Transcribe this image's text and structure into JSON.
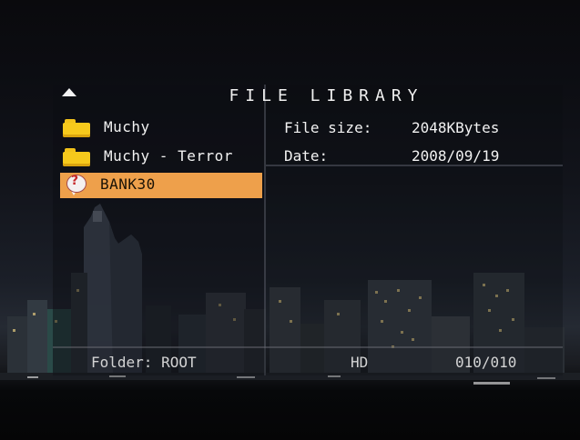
{
  "header": {
    "title": "FILE LIBRARY",
    "up_icon": "up-arrow-icon"
  },
  "list": {
    "items": [
      {
        "label": "Muchy",
        "icon": "folder-icon",
        "selected": false
      },
      {
        "label": "Muchy - Terror",
        "icon": "folder-icon",
        "selected": false
      },
      {
        "label": "BANK30",
        "icon": "unknown-file-icon",
        "selected": true
      }
    ]
  },
  "info": {
    "size_label": "File size:",
    "size_value": "2048KBytes",
    "date_label": "Date:",
    "date_value": "2008/09/19"
  },
  "status": {
    "folder": "Folder: ROOT",
    "device": "HD",
    "count": "010/010"
  },
  "colors": {
    "highlight": "#eea04b",
    "folder": "#f6c91c",
    "text": "#f2f2f2"
  }
}
